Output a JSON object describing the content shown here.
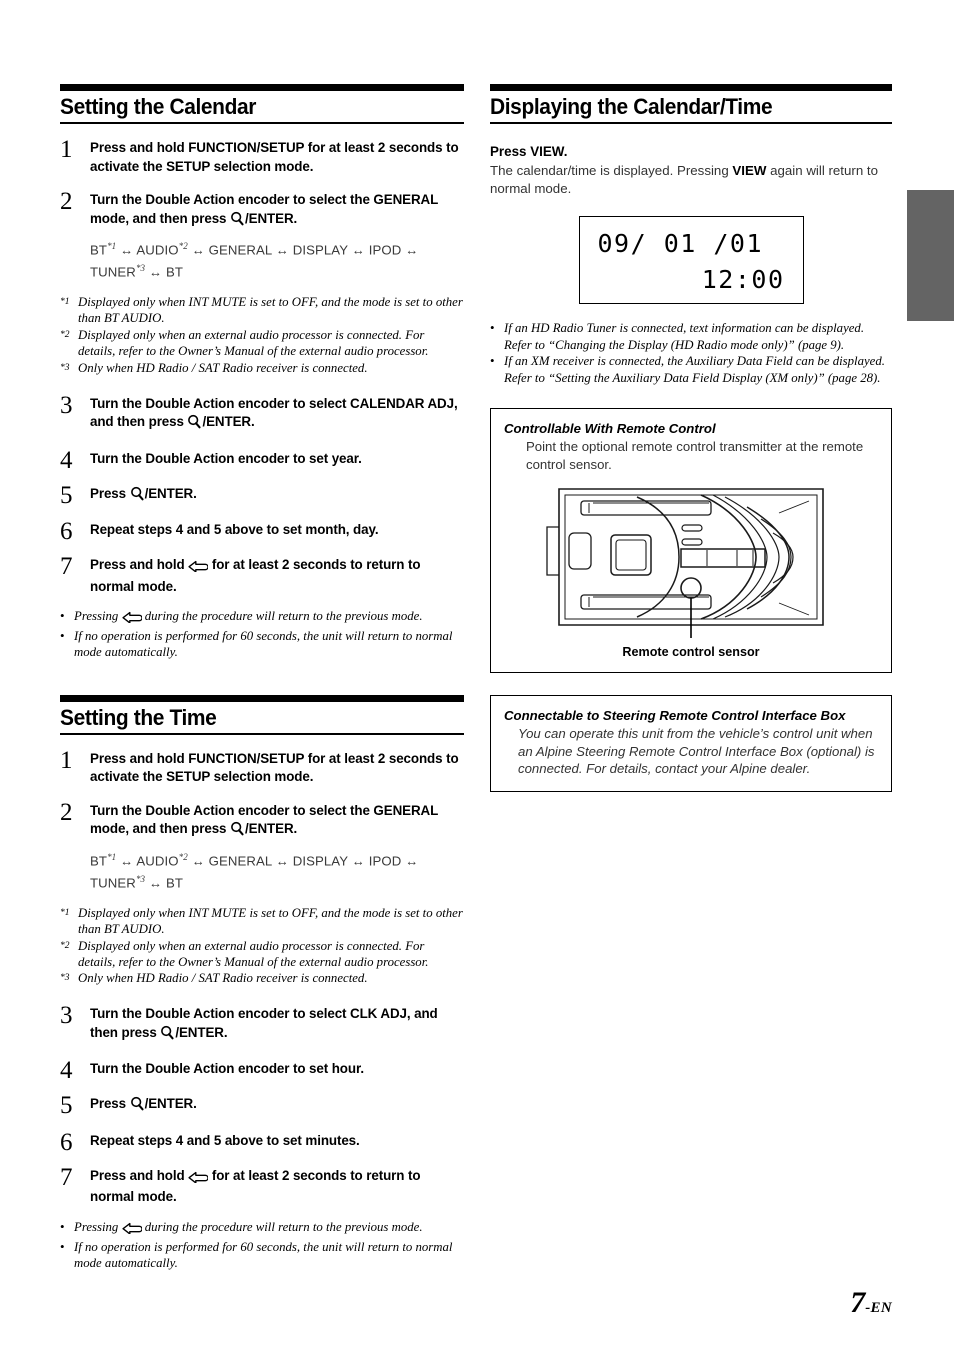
{
  "page": {
    "number": "7",
    "suffix": "-EN"
  },
  "left_column": {
    "section_calendar": {
      "heading": "Setting the Calendar",
      "steps": [
        {
          "num": "1",
          "pre": "Press and hold ",
          "strong": "FUNCTION/SETUP",
          "post": " for at least 2 seconds to activate the SETUP selection mode."
        },
        {
          "num": "2",
          "pre": "Turn the ",
          "strong": "Double Action encoder",
          "post": " to select the GENERAL mode, and then press ",
          "icon": "magnifier-icon",
          "tail": "/ENTER."
        },
        {
          "num": "3",
          "pre": "Turn the ",
          "strong": "Double Action encoder",
          "post": " to select CALENDAR ADJ, and then press ",
          "icon": "magnifier-icon",
          "tail": "/ENTER."
        },
        {
          "num": "4",
          "pre": "Turn the ",
          "strong": "Double Action encoder",
          "post": " to set year."
        },
        {
          "num": "5",
          "pre": "Press ",
          "icon": "magnifier-icon",
          "tail": "/ENTER."
        },
        {
          "num": "6",
          "pre": "Repeat steps 4 and 5 above to set month, day."
        },
        {
          "num": "7",
          "pre": "Press and hold ",
          "icon": "return-arrow-icon",
          "tail": " for at least 2 seconds to return to normal mode."
        }
      ],
      "mode_chain": {
        "part1": "BT",
        "sup1": "*1",
        "part2": " ↔ AUDIO",
        "sup2": "*2",
        "part3": " ↔ GENERAL ↔ DISPLAY ↔ IPOD ↔ TUNER",
        "sup3": "*3",
        "part4": " ↔ BT"
      },
      "footnotes": [
        {
          "mark": "*1",
          "text": "Displayed only when INT MUTE is set to OFF, and the mode is set to other than BT AUDIO."
        },
        {
          "mark": "*2",
          "text": "Displayed only when an external audio processor is connected. For details, refer to the Owner’s Manual of the external audio processor."
        },
        {
          "mark": "*3",
          "text": "Only when HD Radio / SAT Radio receiver is connected."
        }
      ],
      "notes": [
        {
          "pre": "Pressing ",
          "icon": "return-arrow-icon",
          "post": " during the procedure will return to the previous mode."
        },
        {
          "pre": "If no operation is performed for 60 seconds, the unit will return to normal mode automatically."
        }
      ]
    },
    "section_time": {
      "heading": "Setting the Time",
      "steps": [
        {
          "num": "1",
          "pre": "Press and hold ",
          "strong": "FUNCTION/SETUP",
          "post": " for at least 2 seconds to activate the SETUP selection mode."
        },
        {
          "num": "2",
          "pre": "Turn the ",
          "strong": "Double Action encoder",
          "post": " to select the GENERAL mode, and then press ",
          "icon": "magnifier-icon",
          "tail": "/ENTER."
        },
        {
          "num": "3",
          "pre": "Turn the ",
          "strong": "Double Action encoder",
          "post": " to select CLK ADJ, and then press ",
          "icon": "magnifier-icon",
          "tail": "/ENTER."
        },
        {
          "num": "4",
          "pre": "Turn the ",
          "strong": "Double Action encoder",
          "post": " to set hour."
        },
        {
          "num": "5",
          "pre": "Press ",
          "icon": "magnifier-icon",
          "tail": "/ENTER."
        },
        {
          "num": "6",
          "pre": "Repeat steps 4 and 5 above to set minutes."
        },
        {
          "num": "7",
          "pre": "Press and hold ",
          "icon": "return-arrow-icon",
          "tail": " for at least 2 seconds to return to normal mode."
        }
      ],
      "mode_chain": {
        "part1": "BT",
        "sup1": "*1",
        "part2": " ↔ AUDIO",
        "sup2": "*2",
        "part3": " ↔ GENERAL ↔ DISPLAY ↔ IPOD ↔ TUNER",
        "sup3": "*3",
        "part4": " ↔ BT"
      },
      "footnotes": [
        {
          "mark": "*1",
          "text": "Displayed only when INT MUTE is set to OFF, and the mode is set to other than BT AUDIO."
        },
        {
          "mark": "*2",
          "text": "Displayed only when an external audio processor is connected. For details, refer to the Owner’s Manual of the external audio processor."
        },
        {
          "mark": "*3",
          "text": "Only when HD Radio / SAT Radio receiver is connected."
        }
      ],
      "notes": [
        {
          "pre": "Pressing ",
          "icon": "return-arrow-icon",
          "post": " during the procedure will return to the previous mode."
        },
        {
          "pre": "If no operation is performed for 60 seconds, the unit will return to normal mode automatically."
        }
      ]
    }
  },
  "right_column": {
    "section_display": {
      "heading": "Displaying the Calendar/Time",
      "lead_pre": "Press ",
      "lead_strong": "VIEW",
      "lead_post": ".",
      "body_pre": "The calendar/time is displayed. Pressing ",
      "body_strong": "VIEW",
      "body_post": " again will return to normal mode.",
      "lcd": {
        "line1": "09/ 01 /01",
        "line2": "12:00"
      },
      "notes": [
        {
          "text": "If an HD Radio Tuner is connected, text information can be displayed. Refer to “Changing the Display (HD Radio mode only)” (page 9)."
        },
        {
          "text": "If an XM receiver is connected, the Auxiliary Data Field can be displayed. Refer to “Setting the Auxiliary Data Field Display (XM only)” (page 28)."
        }
      ]
    },
    "remote_box": {
      "title": "Controllable With Remote Control",
      "body": "Point the optional remote control transmitter at the remote control sensor.",
      "illustration_caption": "Remote control sensor"
    },
    "steering_box": {
      "title": "Connectable to Steering Remote Control Interface Box",
      "body": "You can operate this unit from the vehicle’s control unit when an Alpine Steering Remote Control Interface Box (optional) is connected. For details, contact your Alpine dealer."
    }
  },
  "colors": {
    "rule": "#000000",
    "edge_tab": "#646464",
    "body_text": "#333333"
  }
}
